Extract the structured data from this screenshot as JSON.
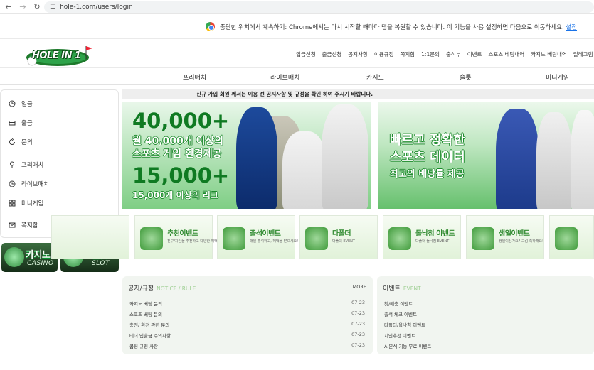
{
  "browser": {
    "url": "hole-1.com/users/login"
  },
  "notice": {
    "text": "중단한 위치에서 계속하기: Chrome에서는 다시 시작할 때마다 탭을 복원할 수 있습니다. 이 기능을 사용 설정하면 다음으로 이동하세요.",
    "link": "설정"
  },
  "header": {
    "logo_text": "HOLE IN 1",
    "menu": [
      "입금신청",
      "출금신청",
      "공지사항",
      "이용규정",
      "쪽지함",
      "1:1문의",
      "출석부",
      "이벤트",
      "스포츠 베팅내역",
      "카지노 베팅내역",
      "릴레그램 문의"
    ]
  },
  "categories": [
    "프리매치",
    "라이브매치",
    "카지노",
    "슬롯",
    "미니게임"
  ],
  "sidebar": {
    "items": [
      {
        "label": "입금",
        "icon": "clock-icon"
      },
      {
        "label": "출금",
        "icon": "card-icon"
      },
      {
        "label": "문의",
        "icon": "refresh-icon"
      },
      {
        "label": "프리매치",
        "icon": "pin-icon"
      },
      {
        "label": "라이브매치",
        "icon": "clock-icon"
      },
      {
        "label": "미니게임",
        "icon": "grid-icon"
      },
      {
        "label": "쪽지함",
        "icon": "mail-icon"
      }
    ]
  },
  "games": {
    "casino": {
      "kr": "카지노",
      "en": "CASINO"
    },
    "slot": {
      "kr": "슬롯",
      "en": "SLOT"
    }
  },
  "announcement": "신규 가입 회원 께서는 이용 전 공지사항 및 규정을 확인 하여 주시기 바랍니다.",
  "banner1": {
    "num1": "40,000+",
    "line1": "월 40,000개 이상의",
    "line2": "스포츠 게임 환경제공",
    "num2": "15,000+",
    "line3": "15,000개 이상의 리그"
  },
  "banner2": {
    "line1": "빠르고 정확한",
    "line2": "스포츠 데이터",
    "line3": "최고의 배당률 제공"
  },
  "events": [
    {
      "title": "추천이벤트",
      "small": "친구/지인을 추천하고 다양한 혜택을 받으세요!"
    },
    {
      "title": "출석이벤트",
      "small": "매일 출석하고, 혜택을 받으세요!"
    },
    {
      "title": "다폴더",
      "small": "다폴더 EVENT"
    },
    {
      "title": "돌낙첨 이벤트",
      "small": "다폴더 돌낙첨 EVENT"
    },
    {
      "title": "생일이벤트",
      "small": "생일이신가요? 그럼 축하해요!"
    }
  ],
  "notice_panel": {
    "title": "공지/규정",
    "title_en": "NOTICE / RULE",
    "more": "MORE",
    "rows": [
      {
        "title": "카지노 베팅 문의",
        "date": "07-23"
      },
      {
        "title": "스포츠 베팅 문의",
        "date": "07-23"
      },
      {
        "title": "충전/ 환전 관련 문의",
        "date": "07-23"
      },
      {
        "title": "테더 입출금 주의사항",
        "date": "07-23"
      },
      {
        "title": "콤팅 규정 사항",
        "date": "07-23"
      }
    ]
  },
  "event_panel": {
    "title": "이벤트",
    "title_en": "EVENT",
    "rows": [
      "첫/매충 이벤트",
      "출석 체크 이벤트",
      "다폴더/올낙첨 이벤트",
      "지인추천 이벤트",
      "AI분석 기능 무료 이벤트"
    ]
  },
  "colors": {
    "accent_green": "#2f8a2f",
    "link_blue": "#1a73e8"
  }
}
